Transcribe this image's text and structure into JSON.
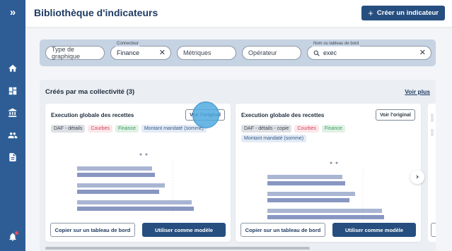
{
  "header": {
    "title": "Bibliothèque d'indicateurs",
    "create_button": "Créer un indicateur"
  },
  "filters": {
    "chart_type": {
      "placeholder": "Type de graphique"
    },
    "connector": {
      "label": "Connecteur",
      "value": "Finance"
    },
    "metrics": {
      "placeholder": "Métriques"
    },
    "operator": {
      "placeholder": "Opérateur"
    },
    "dashboard_name": {
      "label": "Nom ou tableau de bord",
      "value": "exec"
    }
  },
  "section": {
    "title": "Créés par ma collectivité (3)",
    "see_more": "Voir plus"
  },
  "cards": [
    {
      "title": "Execution globale des recettes",
      "original_button": "Voir l'original",
      "tags": [
        "DAF - détails",
        "Courbes",
        "Finance",
        "Montant mandaté (somme)"
      ],
      "copy_button": "Copier sur un tableau de bord",
      "model_button": "Utiliser comme modèle"
    },
    {
      "title": "Execution globale des recettes",
      "original_button": "Voir l'original",
      "tags": [
        "DAF - détails - copie",
        "Courbes",
        "Finance",
        "Montant mandaté (somme)"
      ],
      "copy_button": "Copier sur un tableau de bord",
      "model_button": "Utiliser comme modèle"
    }
  ],
  "next_arrow": "›",
  "colors": {
    "sidebar": "#2e5d96",
    "primary": "#264f80",
    "bar_light": "#a9b5d3",
    "bar_dark": "#8896c2"
  }
}
